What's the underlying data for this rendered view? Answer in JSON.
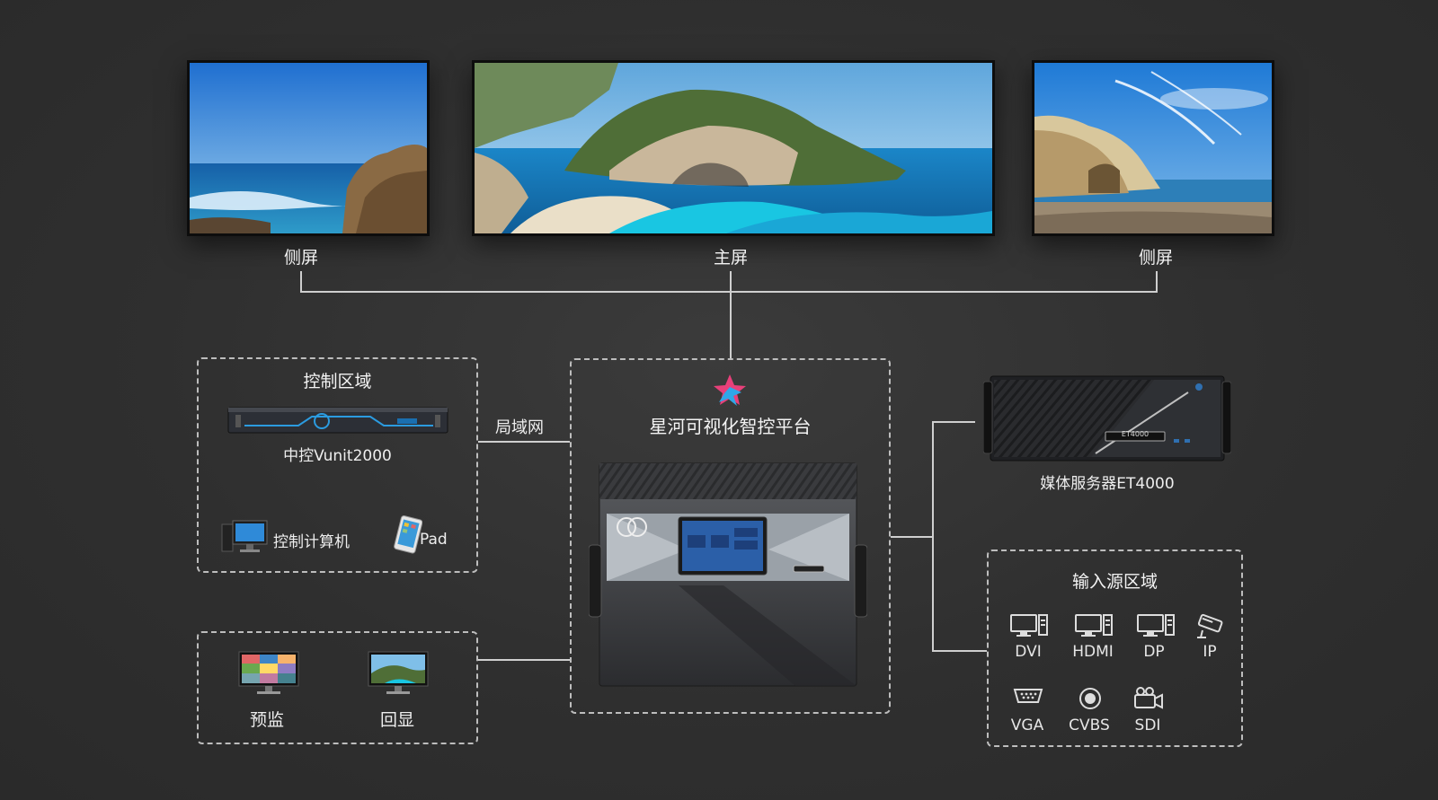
{
  "screens": {
    "left_label": "侧屏",
    "main_label": "主屏",
    "right_label": "侧屏"
  },
  "control_zone": {
    "title": "控制区域",
    "vunit_label": "中控Vunit2000",
    "pc_label": "控制计算机",
    "pad_label": "Pad"
  },
  "lan_label": "局域网",
  "platform": {
    "title": "星河可视化智控平台"
  },
  "monitor_zone": {
    "preview_label": "预监",
    "echo_label": "回显"
  },
  "media_server": {
    "label": "媒体服务器ET4000",
    "badge": "ET4000"
  },
  "input_zone": {
    "title": "输入源区域",
    "sources": [
      "DVI",
      "HDMI",
      "DP",
      "IP",
      "VGA",
      "CVBS",
      "SDI"
    ]
  },
  "colors": {
    "background": "#2f2f2f",
    "line": "#cfcfcf",
    "dash": "#bdbdbd",
    "text": "#ffffff",
    "logo_pink": "#e8407a",
    "logo_blue": "#2fa7e8"
  }
}
